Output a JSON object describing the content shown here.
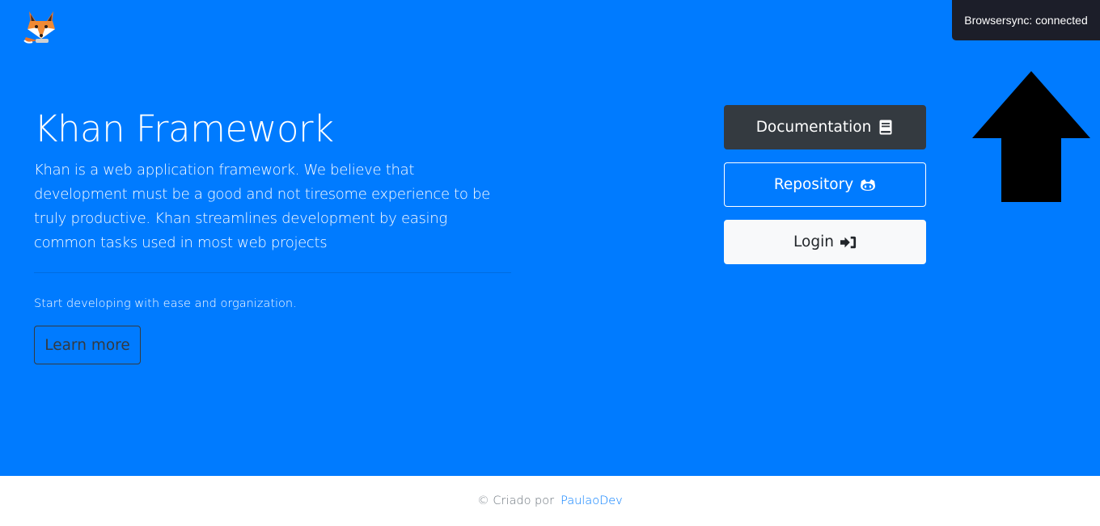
{
  "logo": {
    "icon": "fox-logo-icon"
  },
  "hero": {
    "title": "Khan Framework",
    "lead": "Khan is a web application framework. We believe that development must be a good and not tiresome experience to be truly productive. Khan streamlines development by easing common tasks used in most web projects",
    "subtext": "Start developing with ease and organization.",
    "learn_more_label": "Learn more",
    "background_color": "#007bff"
  },
  "actions": {
    "documentation": {
      "label": "Documentation",
      "icon": "book-icon"
    },
    "repository": {
      "label": "Repository",
      "icon": "github-icon"
    },
    "login": {
      "label": "Login",
      "icon": "sign-in-icon"
    }
  },
  "browsersync": {
    "text": "Browsersync: connected"
  },
  "annotation": {
    "icon": "up-arrow-icon"
  },
  "footer": {
    "prefix": "© Criado por",
    "author": "PaulaoDev",
    "link_color": "#007bff"
  }
}
